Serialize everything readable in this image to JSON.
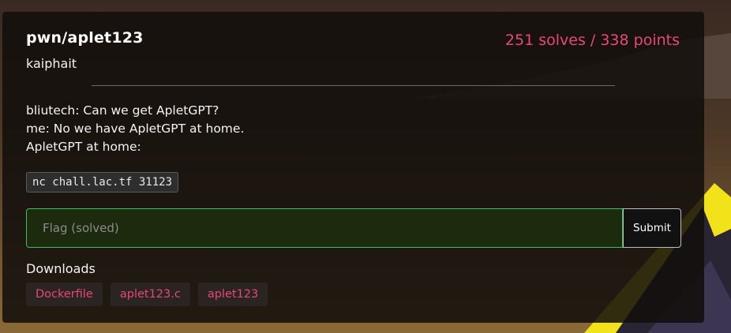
{
  "challenge": {
    "title": "pwn/aplet123",
    "score": "251 solves / 338 points",
    "author": "kaiphait",
    "description": [
      "bliutech: Can we get ApletGPT?",
      "me: No we have ApletGPT at home.",
      "ApletGPT at home:"
    ],
    "connection": "nc chall.lac.tf 31123"
  },
  "flag_form": {
    "placeholder": "Flag (solved)",
    "value": "",
    "submit_label": "Submit"
  },
  "downloads": {
    "label": "Downloads",
    "files": [
      "Dockerfile",
      "aplet123.c",
      "aplet123"
    ]
  },
  "colors": {
    "accent": "#e8477a",
    "input_border": "#3fbf5c",
    "card_bg": "#120e0c"
  }
}
